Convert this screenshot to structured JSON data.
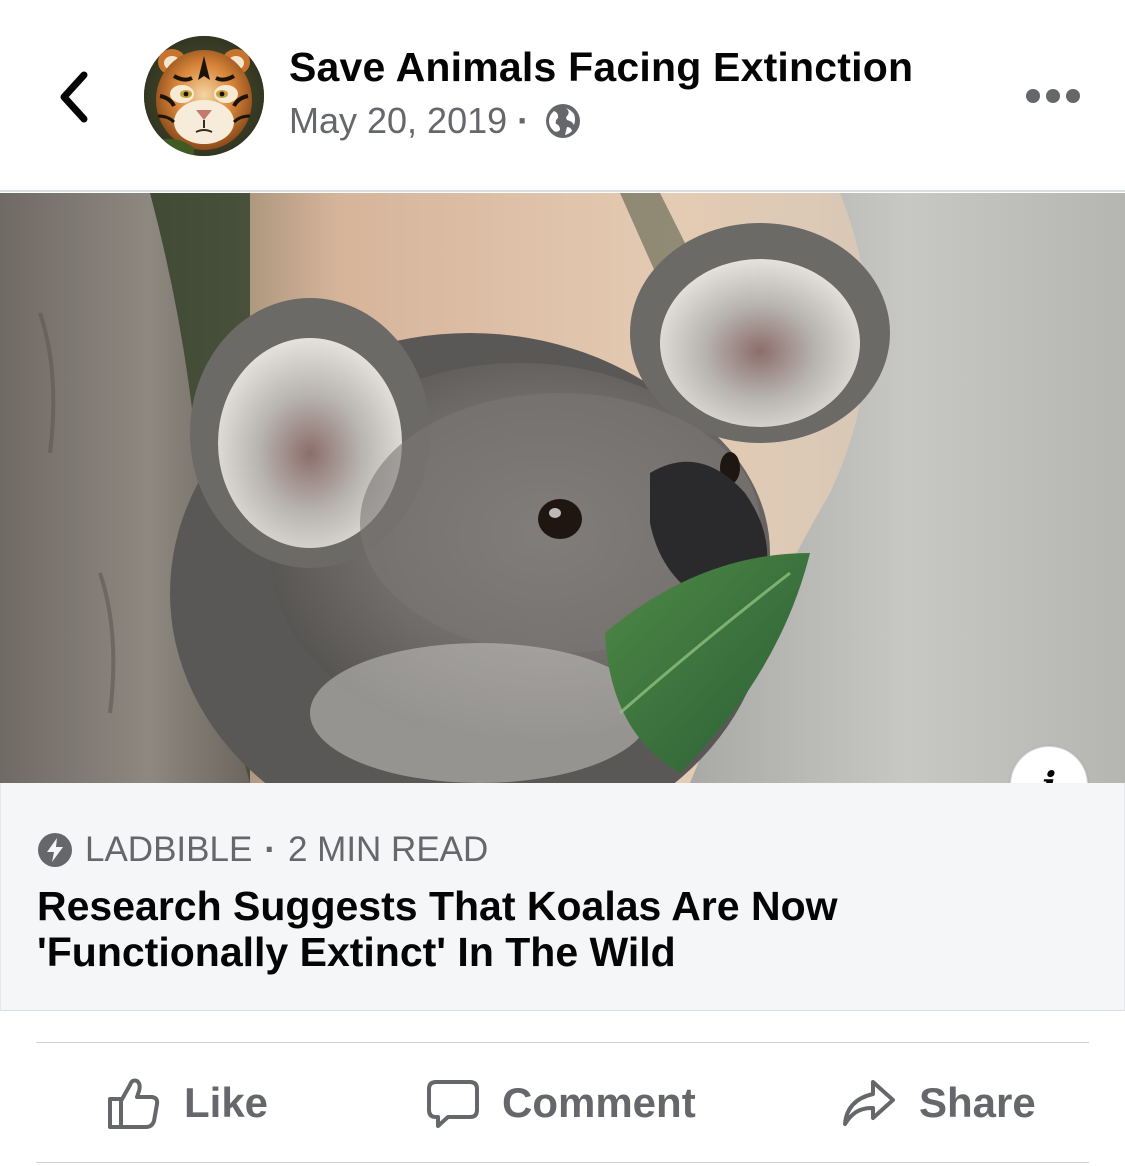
{
  "header": {
    "back_icon": "chevron-left-icon",
    "page_name": "Save Animals Facing Extinction",
    "date": "May 20, 2019",
    "separator": "·",
    "audience_icon": "globe-icon",
    "more_icon": "more-horizontal-icon"
  },
  "media": {
    "subject": "koala-photo",
    "info_label": "i"
  },
  "link_preview": {
    "source_icon": "lightning-bolt-icon",
    "source": "LADBIBLE",
    "separator": "·",
    "read_time": "2 MIN READ",
    "headline": "Research Suggests That Koalas Are Now 'Functionally Extinct' In The Wild"
  },
  "actions": {
    "like_label": "Like",
    "comment_label": "Comment",
    "share_label": "Share"
  },
  "colors": {
    "text_primary": "#050505",
    "text_secondary": "#65676b",
    "card_background": "#f5f6f8",
    "divider": "#ced0d4"
  }
}
